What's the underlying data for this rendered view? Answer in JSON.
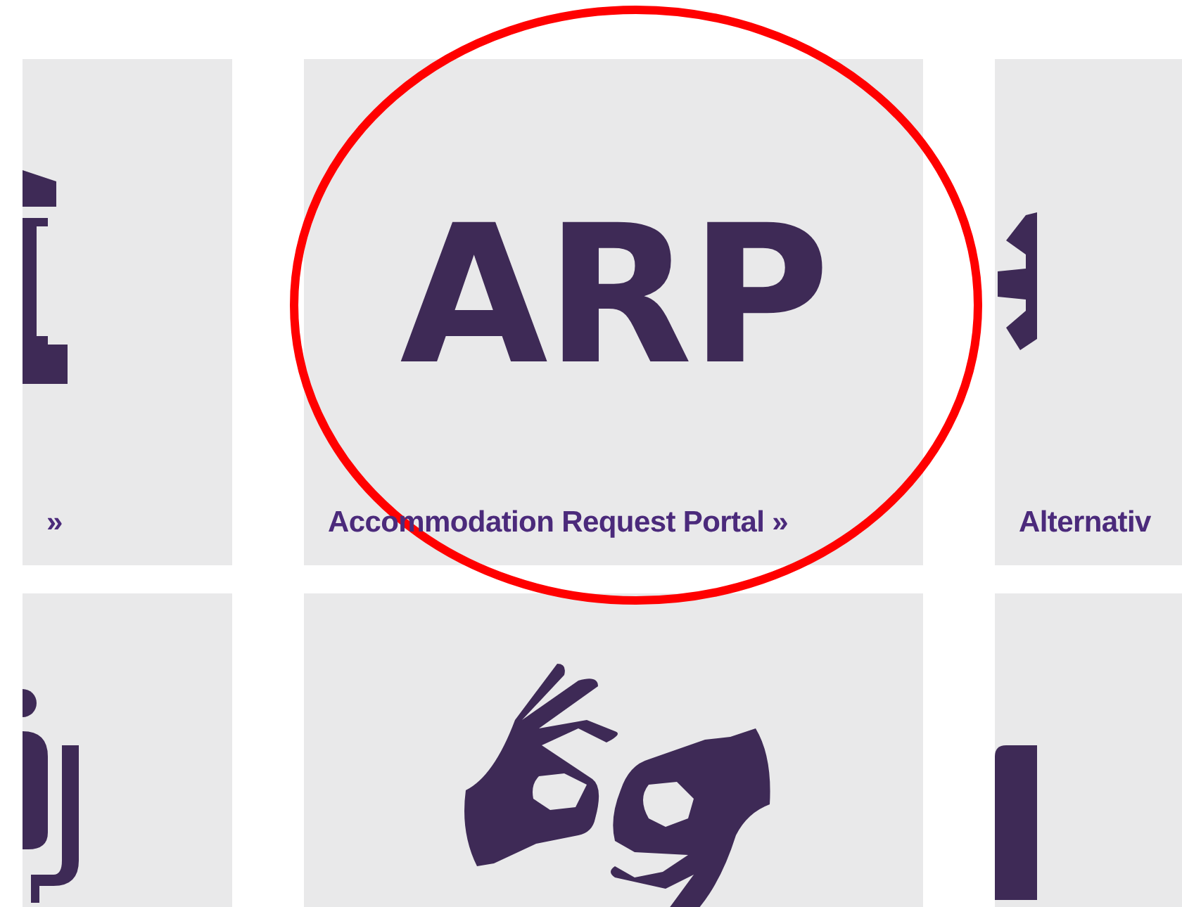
{
  "rows": [
    [
      {
        "kind": "icon",
        "label": "»"
      },
      {
        "kind": "logo",
        "logo": "ARP",
        "label": "Accommodation Request Portal »"
      },
      {
        "kind": "icon",
        "label": "Alternativ"
      }
    ],
    [
      {
        "kind": "icon"
      },
      {
        "kind": "icon"
      },
      {
        "kind": "icon"
      }
    ]
  ]
}
